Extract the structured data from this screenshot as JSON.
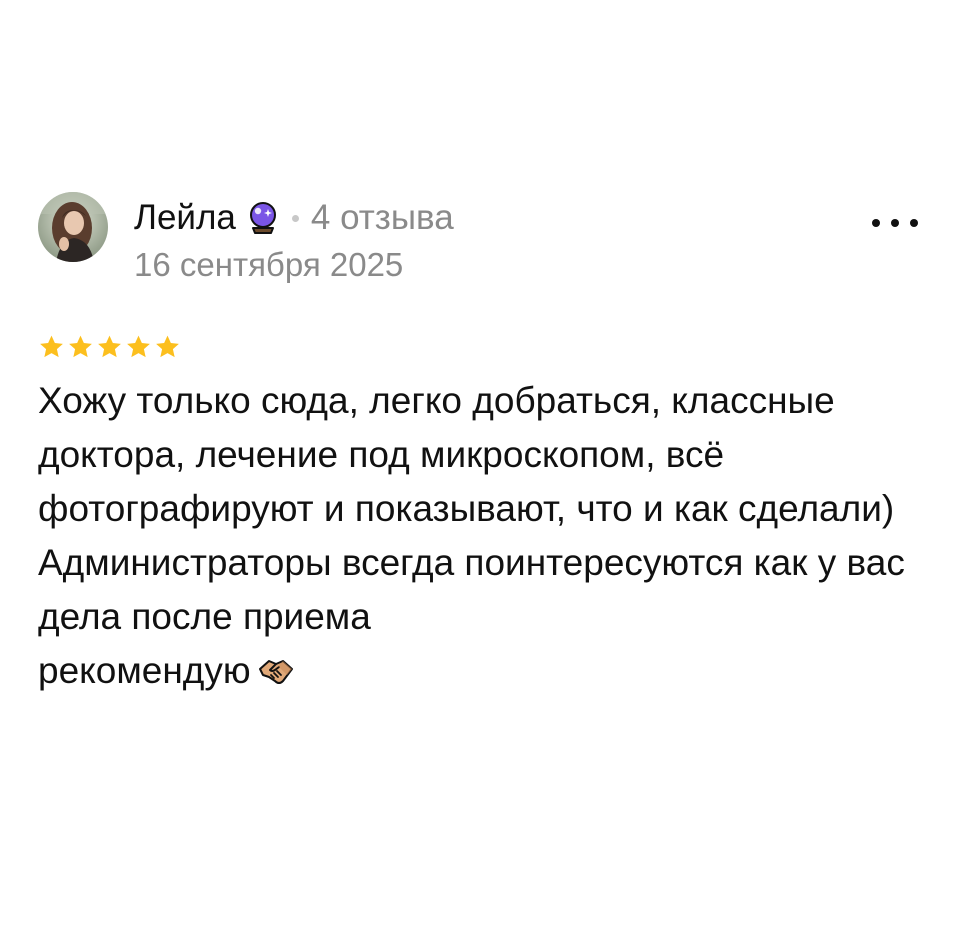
{
  "review": {
    "author": {
      "name": "Лейла",
      "badge_icon": "crystal-ball-icon",
      "reviews_count": "4 отзыва"
    },
    "date": "16 сентября 2025",
    "rating": {
      "value": 5,
      "max": 5,
      "star_color": "#fcbf1e"
    },
    "text": {
      "paragraph_1": "Хожу только сюда, легко добраться, классные доктора, лечение под микроскопом, всё фотографируют и показывают, что и как сделали)",
      "paragraph_2": "Администраторы всегда поинтересуются как у вас дела после приема",
      "paragraph_3": "рекомендую",
      "closing_emoji": "handshake-icon"
    },
    "more_menu_icon": "more-horizontal-icon"
  },
  "colors": {
    "text_primary": "#111111",
    "text_secondary": "#8a8a8a",
    "badge_purple": "#7a55e6"
  }
}
